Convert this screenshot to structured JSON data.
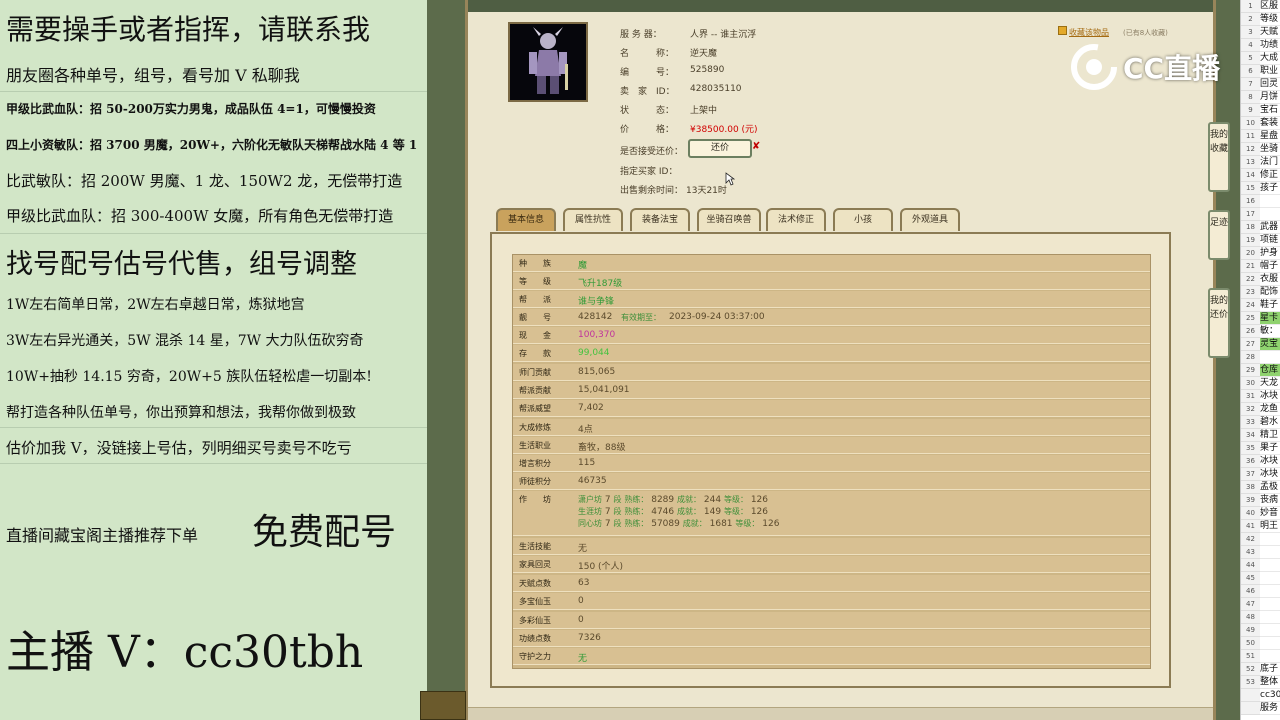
{
  "left_panel": {
    "lines": [
      "需要操手或者指挥，请联系我",
      "朋友圈各种单号，组号，看号加 V 私聊我",
      "甲级比武血队：招 50-200万实力男鬼，成品队伍 4=1，可慢慢投资",
      "四上小资敏队：招 3700 男魔，20W+，六阶化无敏队天梯帮战水陆 4 等 1",
      "比武敏队：招 200W 男魔、1 龙、150W2 龙，无偿带打造",
      "甲级比武血队：招 300-400W 女魔，所有角色无偿带打造",
      "找号配号估号代售，组号调整",
      "1W左右简单日常，2W左右卓越日常，炼狱地宫",
      "3W左右异光通关，5W 混杀 14 星，7W 大力队伍砍穷奇",
      "10W+抽秒 14.15 穷奇，20W+5 族队伍轻松虐一切副本!",
      "帮打造各种队伍单号，你出预算和想法，我帮你做到极致",
      "估价加我 V，没链接上号估，列明细买号卖号不吃亏",
      "直播间藏宝阁主播推荐下单",
      "免费配号",
      "主播 V：cc30tbh"
    ]
  },
  "char_info": {
    "rows": [
      {
        "label": "服 务 器：",
        "value": "人界 -- 谁主沉浮"
      },
      {
        "label": "名　　　称：",
        "value": "逆天魔"
      },
      {
        "label": "编　　　号：",
        "value": "525890"
      },
      {
        "label": "卖　家　ID：",
        "value": "428035110"
      },
      {
        "label": "状　　　态：",
        "value": "上架中"
      },
      {
        "label": "价　　　格：",
        "value": "¥38500.00 (元)"
      },
      {
        "label": "是否接受还价：",
        "value": ""
      },
      {
        "label": "指定买家 ID：",
        "value": ""
      },
      {
        "label": "出售剩余时间：",
        "value": "13天21时"
      }
    ],
    "counter_button": "还价",
    "close_mark": "✘",
    "collect_link": "收藏该物品",
    "collect_note": "(已有8人收藏)"
  },
  "tabs": [
    "基本信息",
    "属性抗性",
    "装备法宝",
    "坐骑召唤兽",
    "法术修正",
    "小孩",
    "外观道具"
  ],
  "stats": [
    {
      "label": "种　　族",
      "value": "魔",
      "style": "green"
    },
    {
      "label": "等　　级",
      "value": "飞升187级",
      "style": "green"
    },
    {
      "label": "帮　　派",
      "value": "谁与争锋",
      "style": "green"
    },
    {
      "label": "靓　　号",
      "value": "428142"
    },
    {
      "label": "现　　金",
      "value": "100,370",
      "style": "pink"
    },
    {
      "label": "存　　款",
      "value": "99,044",
      "style": "lime"
    },
    {
      "label": "师门贡献",
      "value": "815,065"
    },
    {
      "label": "帮派贡献",
      "value": "15,041,091"
    },
    {
      "label": "帮派威望",
      "value": "7,402"
    },
    {
      "label": "大成修炼",
      "value": "4点"
    },
    {
      "label": "生活职业",
      "value": "畜牧，88级"
    },
    {
      "label": "增言积分",
      "value": "115"
    },
    {
      "label": "师徒积分",
      "value": "46735"
    },
    {
      "label": "作　　坊",
      "value": ""
    },
    {
      "label": "生活技能",
      "value": "无"
    },
    {
      "label": "家具回灵",
      "value": "150 (个人)"
    },
    {
      "label": "天赋点数",
      "value": "63"
    },
    {
      "label": "多宝仙玉",
      "value": "0"
    },
    {
      "label": "多彩仙玉",
      "value": "0"
    },
    {
      "label": "功绩点数",
      "value": "7326"
    },
    {
      "label": "守护之力",
      "value": "无",
      "style": "green"
    }
  ],
  "expiry": {
    "label": "有效期至：",
    "value": "2023-09-24 03:37:00"
  },
  "workshop": [
    {
      "name": "潇户坊",
      "tier": "7",
      "skill": "8289",
      "success": "244",
      "level": "126"
    },
    {
      "name": "生涯坊",
      "tier": "7",
      "skill": "4746",
      "success": "149",
      "level": "126"
    },
    {
      "name": "同心坊",
      "tier": "7",
      "skill": "57089",
      "success": "1681",
      "level": "126"
    }
  ],
  "workshop_labels": {
    "tier": "段",
    "skill": "熟练：",
    "success": "成就：",
    "level": "等级："
  },
  "side_buttons": [
    "我的收藏",
    "足迹",
    "我的还价"
  ],
  "watermark": {
    "text": "CC直播"
  },
  "spreadsheet": {
    "rows": [
      {
        "n": "1",
        "t": "区服"
      },
      {
        "n": "2",
        "t": "等级"
      },
      {
        "n": "3",
        "t": "天赋"
      },
      {
        "n": "4",
        "t": "功绩"
      },
      {
        "n": "5",
        "t": "大成"
      },
      {
        "n": "6",
        "t": "职业"
      },
      {
        "n": "7",
        "t": "回灵"
      },
      {
        "n": "8",
        "t": "月饼"
      },
      {
        "n": "9",
        "t": "宝石"
      },
      {
        "n": "10",
        "t": "套装"
      },
      {
        "n": "11",
        "t": "星盘"
      },
      {
        "n": "12",
        "t": "坐骑"
      },
      {
        "n": "13",
        "t": "法门"
      },
      {
        "n": "14",
        "t": "修正"
      },
      {
        "n": "15",
        "t": "孩子"
      },
      {
        "n": "16",
        "t": ""
      },
      {
        "n": "17",
        "t": ""
      },
      {
        "n": "18",
        "t": "武器"
      },
      {
        "n": "19",
        "t": "项链"
      },
      {
        "n": "20",
        "t": "护身"
      },
      {
        "n": "21",
        "t": "帽子"
      },
      {
        "n": "22",
        "t": "衣服"
      },
      {
        "n": "23",
        "t": "配饰"
      },
      {
        "n": "24",
        "t": "鞋子"
      },
      {
        "n": "25",
        "t": "星卡",
        "hl": true
      },
      {
        "n": "26",
        "t": "敏："
      },
      {
        "n": "27",
        "t": "灵宝",
        "hl": true
      },
      {
        "n": "28",
        "t": ""
      },
      {
        "n": "29",
        "t": "仓库",
        "hl": true
      },
      {
        "n": "30",
        "t": "天龙"
      },
      {
        "n": "31",
        "t": "冰块"
      },
      {
        "n": "32",
        "t": "龙鱼"
      },
      {
        "n": "33",
        "t": "碧水"
      },
      {
        "n": "34",
        "t": "精卫"
      },
      {
        "n": "35",
        "t": "果子"
      },
      {
        "n": "36",
        "t": "冰块"
      },
      {
        "n": "37",
        "t": "冰块"
      },
      {
        "n": "38",
        "t": "孟极"
      },
      {
        "n": "39",
        "t": "丧病"
      },
      {
        "n": "40",
        "t": "妙音"
      },
      {
        "n": "41",
        "t": "明王"
      },
      {
        "n": "42",
        "t": ""
      },
      {
        "n": "43",
        "t": ""
      },
      {
        "n": "44",
        "t": ""
      },
      {
        "n": "45",
        "t": ""
      },
      {
        "n": "46",
        "t": ""
      },
      {
        "n": "47",
        "t": ""
      },
      {
        "n": "48",
        "t": ""
      },
      {
        "n": "49",
        "t": ""
      },
      {
        "n": "50",
        "t": ""
      },
      {
        "n": "51",
        "t": ""
      },
      {
        "n": "52",
        "t": "底子"
      },
      {
        "n": "53",
        "t": "整体"
      },
      {
        "n": "",
        "t": "cc30"
      },
      {
        "n": "",
        "t": "服务"
      }
    ]
  }
}
